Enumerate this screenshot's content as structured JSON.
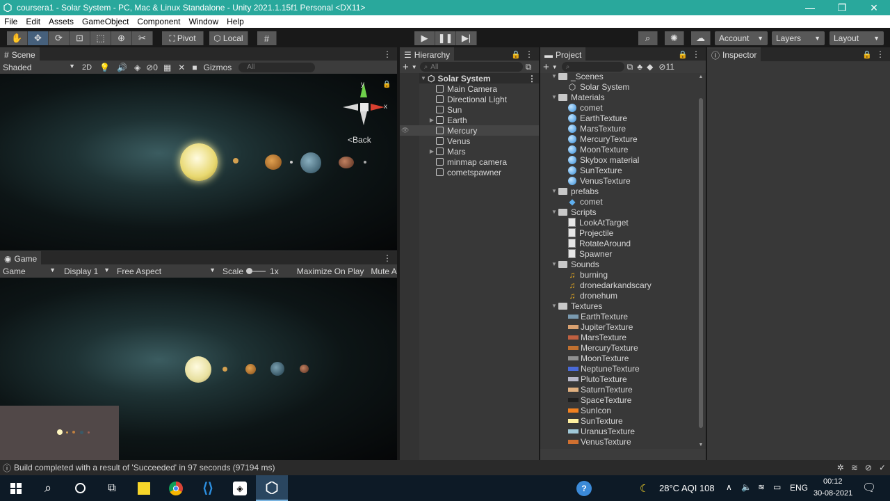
{
  "window": {
    "title": "coursera1 - Solar System - PC, Mac & Linux Standalone - Unity 2021.1.15f1 Personal <DX11>",
    "minimize": "—",
    "maximize": "❐",
    "close": "✕"
  },
  "menu": [
    "File",
    "Edit",
    "Assets",
    "GameObject",
    "Component",
    "Window",
    "Help"
  ],
  "toolbar": {
    "pivot": "Pivot",
    "local": "Local",
    "account": "Account",
    "layers": "Layers",
    "layout": "Layout"
  },
  "scene": {
    "tab": "Scene",
    "shading": "Shaded",
    "mode2d": "2D",
    "hidden_count": "0",
    "gizmos": "Gizmos",
    "search_placeholder": "All",
    "gizmo_back": "Back",
    "axis_x": "x",
    "axis_y": "y"
  },
  "game": {
    "tab": "Game",
    "mode": "Game",
    "display": "Display 1",
    "aspect": "Free Aspect",
    "scale_label": "Scale",
    "scale_value": "1x",
    "maximize": "Maximize On Play",
    "mute": "Mute A"
  },
  "hierarchy": {
    "tab": "Hierarchy",
    "search_placeholder": "All",
    "scene_name": "Solar System",
    "items": [
      {
        "name": "Main Camera",
        "expandable": false
      },
      {
        "name": "Directional Light",
        "expandable": false
      },
      {
        "name": "Sun",
        "expandable": false
      },
      {
        "name": "Earth",
        "expandable": true
      },
      {
        "name": "Mercury",
        "expandable": false
      },
      {
        "name": "Venus",
        "expandable": false
      },
      {
        "name": "Mars",
        "expandable": true
      },
      {
        "name": "minmap camera",
        "expandable": false
      },
      {
        "name": "cometspawner",
        "expandable": false
      }
    ]
  },
  "project": {
    "tab": "Project",
    "hidden_count": "11",
    "scenes_folder": "_Scenes",
    "scene_file": "Solar System",
    "materials_folder": "Materials",
    "materials": [
      "comet",
      "EarthTexture",
      "MarsTexture",
      "MercuryTexture",
      "MoonTexture",
      "Skybox material",
      "SunTexture",
      "VenusTexture"
    ],
    "prefabs_folder": "prefabs",
    "prefabs": [
      "comet"
    ],
    "scripts_folder": "Scripts",
    "scripts": [
      "LookAtTarget",
      "Projectile",
      "RotateAround",
      "Spawner"
    ],
    "sounds_folder": "Sounds",
    "sounds": [
      "burning",
      "dronedarkandscary",
      "dronehum"
    ],
    "textures_folder": "Textures",
    "textures": [
      {
        "name": "EarthTexture",
        "color": "#7a9ab0"
      },
      {
        "name": "JupiterTexture",
        "color": "#d8a070"
      },
      {
        "name": "MarsTexture",
        "color": "#c06040"
      },
      {
        "name": "MercuryTexture",
        "color": "#c07030"
      },
      {
        "name": "MoonTexture",
        "color": "#909090"
      },
      {
        "name": "NeptuneTexture",
        "color": "#4a6ad8"
      },
      {
        "name": "PlutoTexture",
        "color": "#b8b8c8"
      },
      {
        "name": "SaturnTexture",
        "color": "#e0b080"
      },
      {
        "name": "SpaceTexture",
        "color": "#202020"
      },
      {
        "name": "SunIcon",
        "color": "#f08020"
      },
      {
        "name": "SunTexture",
        "color": "#fff0a0"
      },
      {
        "name": "UranusTexture",
        "color": "#a0c8d8"
      },
      {
        "name": "VenusTexture",
        "color": "#d07030"
      }
    ]
  },
  "inspector": {
    "tab": "Inspector"
  },
  "status": {
    "message": "Build completed with a result of 'Succeeded' in 97 seconds (97194 ms)"
  },
  "taskbar": {
    "weather": "28°C AQI 108",
    "lang": "ENG",
    "time": "00:12",
    "date": "30-08-2021"
  }
}
